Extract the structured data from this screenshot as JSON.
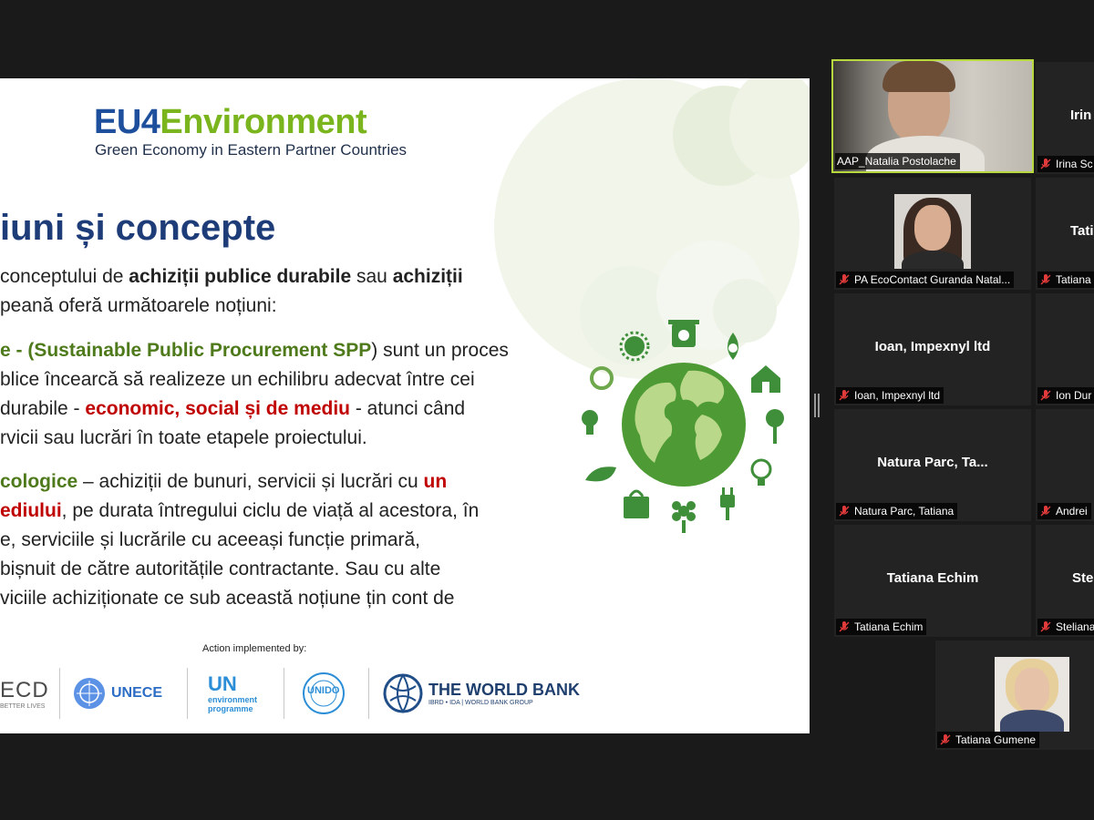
{
  "slide": {
    "logo_eu": "EU4",
    "logo_env": "Environment",
    "logo_subtitle": "Green Economy in Eastern Partner Countries",
    "heading": "iuni și concepte",
    "para1_line1_a": "conceptului de ",
    "para1_line1_b": "achiziții publice durabile",
    "para1_line1_c": " sau ",
    "para1_line1_d": "achiziții",
    "para1_line2": "peană oferă următoarele noțiuni:",
    "para2_line1_a": "e - (",
    "para2_line1_b": "Sustainable Public Procurement SPP",
    "para2_line1_c": ") sunt un proces",
    "para2_line2": "blice încearcă să realizeze un echilibru adecvat între cei",
    "para2_line3_a": "durabile - ",
    "para2_line3_b": "economic, social și de mediu",
    "para2_line3_c": " - atunci când",
    "para2_line4": "rvicii sau lucrări în toate etapele proiectului.",
    "para3_line1_a": "cologice",
    "para3_line1_b": " – achiziții de bunuri, servicii și lucrări cu ",
    "para3_line1_c": "un",
    "para3_line2_a": "ediului",
    "para3_line2_b": ", pe durata întregului ciclu de viață al acestora, în",
    "para3_line3": "e, serviciile și lucrările cu aceeași funcție primară,",
    "para3_line4": "bișnuit de către autoritățile contractante. Sau cu alte",
    "para3_line5": "viciile achiziționate ce sub această noțiune țin cont de",
    "action_label": "Action implemented by:",
    "partners": {
      "oecd": "ECD",
      "oecd_sub": "BETTER LIVES",
      "unece": "UNECE",
      "unep_top": "UN",
      "unep_bottom1": "environment",
      "unep_bottom2": "programme",
      "unido": "UNIDO",
      "worldbank": "THE WORLD BANK",
      "worldbank_sub": "IBRD • IDA | WORLD BANK GROUP"
    },
    "colors": {
      "eu_blue": "#1d4f9c",
      "env_green": "#7ab51d",
      "heading_blue": "#1d3c78",
      "accent_red": "#c00000",
      "accent_green": "#4e7a1b"
    }
  },
  "participants": [
    {
      "label": "AAP_Natalia Postolache",
      "name": "",
      "type": "video",
      "speaking": true,
      "muted": false
    },
    {
      "label": "Irina Sc",
      "name": "Irin",
      "type": "name",
      "muted": true
    },
    {
      "label": "PA EcoContact Guranda Natal...",
      "name": "",
      "type": "photo",
      "muted": true
    },
    {
      "label": "Tatiana",
      "name": "Tati",
      "type": "name",
      "muted": true
    },
    {
      "label": "Ioan, Impexnyl ltd",
      "name": "Ioan, Impexnyl ltd",
      "type": "name",
      "muted": true
    },
    {
      "label": "Ion Dur",
      "name": "",
      "type": "name",
      "muted": true
    },
    {
      "label": "Natura Parc,  Tatiana",
      "name": "Natura Parc,  Ta...",
      "type": "name",
      "muted": true
    },
    {
      "label": "Andrei",
      "name": "",
      "type": "name",
      "muted": true
    },
    {
      "label": "Tatiana Echim",
      "name": "Tatiana Echim",
      "type": "name",
      "muted": true
    },
    {
      "label": "Steliana",
      "name": "Ste",
      "type": "name",
      "muted": true
    },
    {
      "label": "Tatiana Gumene",
      "name": "",
      "type": "photo",
      "muted": true
    }
  ],
  "icons": [
    "muted-mic-icon",
    "earth-globe-icon",
    "recycle-bin-icon",
    "leaf-icon",
    "house-icon",
    "tree-icon",
    "lightbulb-icon",
    "plug-icon",
    "flower-icon",
    "shopping-bag-icon",
    "sun-icon",
    "recycle-arrows-icon",
    "eco-bulb-icon",
    "drop-icon",
    "panel-resize-handle-icon"
  ]
}
